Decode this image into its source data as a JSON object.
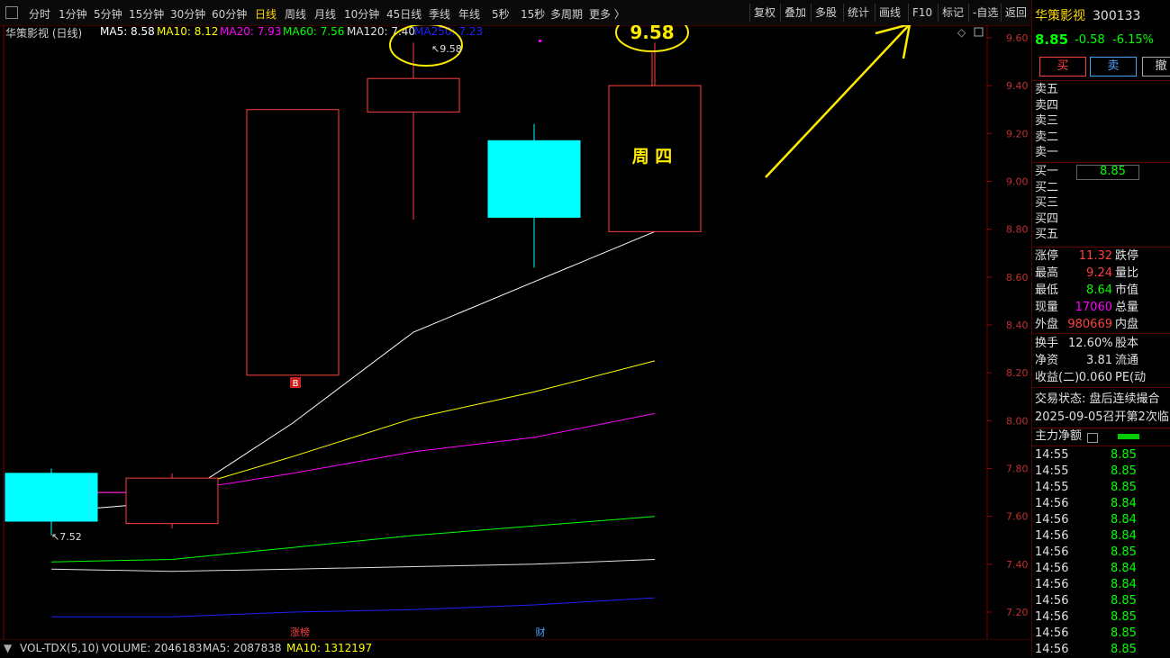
{
  "toolbar": {
    "tabs": [
      "分时",
      "1分钟",
      "5分钟",
      "15分钟",
      "30分钟",
      "60分钟",
      "日线",
      "周线",
      "月线",
      "10分钟",
      "45日线",
      "季线",
      "年线",
      "5秒",
      "15秒",
      "多周期",
      "更多 〉"
    ],
    "right_buttons": [
      "复权",
      "叠加",
      "多股",
      "统计",
      "画线",
      "F10",
      "标记",
      "-自选",
      "返回"
    ]
  },
  "chart_info": {
    "title": "华策影视 (日线)",
    "ma5": "MA5: 8.58",
    "ma10": "MA10: 8.12",
    "ma20": "MA20: 7.93",
    "ma60": "MA60: 7.56",
    "ma120": "MA120: 7.40",
    "ma250": "MA250: 7.23"
  },
  "annotations": {
    "high_label": "9.58",
    "high_marker": "9.58",
    "low_marker": "7.52",
    "weekday": "周 四",
    "b_marker": "B",
    "limit_tag": "涨榜",
    "fin_tag": "财"
  },
  "colors": {
    "up": "#ff4040",
    "down": "#00ffff",
    "ma5": "#ffffff",
    "ma10": "#ffff00",
    "ma20": "#ff00ff",
    "ma60": "#00ff00",
    "ma120": "#e0e0e0",
    "ma250": "#2020ff",
    "highlight": "#ffeb00"
  },
  "chart_data": {
    "type": "candlestick",
    "ylim": [
      7.1,
      9.7
    ],
    "yticks": [
      "9.60",
      "9.40",
      "9.20",
      "9.00",
      "8.80",
      "8.60",
      "8.40",
      "8.20",
      "8.00",
      "7.80",
      "7.60",
      "7.40",
      "7.20"
    ],
    "candles": [
      {
        "open": 7.78,
        "high": 7.8,
        "low": 7.52,
        "close": 7.58,
        "dir": "down"
      },
      {
        "open": 7.57,
        "high": 7.78,
        "low": 7.55,
        "close": 7.76,
        "dir": "up"
      },
      {
        "open": 8.19,
        "high": 9.3,
        "low": 8.19,
        "close": 9.3,
        "dir": "up"
      },
      {
        "open": 9.29,
        "high": 9.58,
        "low": 8.84,
        "close": 9.43,
        "dir": "up"
      },
      {
        "open": 9.17,
        "high": 9.24,
        "low": 8.64,
        "close": 8.85,
        "dir": "down"
      },
      {
        "open": 8.79,
        "high": 9.58,
        "low": 8.79,
        "close": 9.4,
        "dir": "up"
      }
    ],
    "series": [
      {
        "name": "MA5",
        "values": [
          7.62,
          7.66,
          7.99,
          8.37,
          8.58,
          8.79
        ]
      },
      {
        "name": "MA10",
        "values": [
          7.7,
          7.7,
          7.85,
          8.01,
          8.12,
          8.25
        ]
      },
      {
        "name": "MA20",
        "values": [
          7.7,
          7.7,
          7.78,
          7.87,
          7.93,
          8.03
        ]
      },
      {
        "name": "MA60",
        "values": [
          7.41,
          7.42,
          7.47,
          7.52,
          7.56,
          7.6
        ]
      },
      {
        "name": "MA120",
        "values": [
          7.38,
          7.37,
          7.38,
          7.39,
          7.4,
          7.42
        ]
      },
      {
        "name": "MA250",
        "values": [
          7.18,
          7.18,
          7.2,
          7.21,
          7.23,
          7.26
        ]
      }
    ]
  },
  "volume": {
    "label": "VOL-TDX(5,10)",
    "volume": "VOLUME: 2046183",
    "ma5": "MA5: 2087838",
    "ma10": "MA10: 1312197"
  },
  "quote": {
    "name": "华策影视",
    "code": "300133",
    "price": "8.85",
    "change": "-0.58",
    "pct": "-6.15%",
    "buy_label": "买",
    "sell_label": "卖",
    "cancel_label": "撤",
    "ask_levels": [
      "卖五",
      "卖四",
      "卖三",
      "卖二",
      "卖一"
    ],
    "bid_levels": [
      "买一",
      "买二",
      "买三",
      "买四",
      "买五"
    ],
    "bid1_price": "8.85",
    "stats": [
      {
        "label": "涨停",
        "value": "11.32",
        "label2": "跌停",
        "color": "#ff4040"
      },
      {
        "label": "最高",
        "value": "9.24",
        "label2": "量比",
        "color": "#ff4040"
      },
      {
        "label": "最低",
        "value": "8.64",
        "label2": "市值",
        "color": "#00ff00"
      },
      {
        "label": "现量",
        "value": "17060",
        "label2": "总量",
        "color": "#ff00ff"
      },
      {
        "label": "外盘",
        "value": "980669",
        "label2": "内盘",
        "color": "#ff4040"
      }
    ],
    "stats2": [
      {
        "label": "换手",
        "value": "12.60%",
        "label2": "股本"
      },
      {
        "label": "净资",
        "value": "3.81",
        "label2": "流通"
      },
      {
        "label": "收益(二)",
        "value": "0.060",
        "label2": "PE(动"
      }
    ],
    "status": "交易状态: 盘后连续撮合",
    "auction": "2025-09-05召开第2次临",
    "main_flow": "主力净额",
    "ticks": [
      {
        "time": "14:55",
        "price": "8.85"
      },
      {
        "time": "14:55",
        "price": "8.85"
      },
      {
        "time": "14:55",
        "price": "8.85"
      },
      {
        "time": "14:56",
        "price": "8.84"
      },
      {
        "time": "14:56",
        "price": "8.84"
      },
      {
        "time": "14:56",
        "price": "8.84"
      },
      {
        "time": "14:56",
        "price": "8.85"
      },
      {
        "time": "14:56",
        "price": "8.84"
      },
      {
        "time": "14:56",
        "price": "8.84"
      },
      {
        "time": "14:56",
        "price": "8.85"
      },
      {
        "time": "14:56",
        "price": "8.85"
      },
      {
        "time": "14:56",
        "price": "8.85"
      },
      {
        "time": "14:56",
        "price": "8.85"
      }
    ]
  }
}
